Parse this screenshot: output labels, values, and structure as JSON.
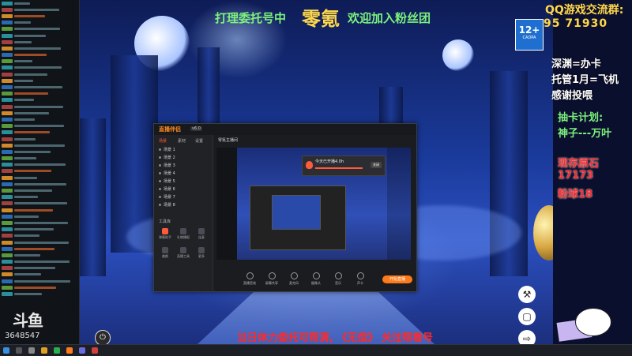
{
  "overlay": {
    "top_left": "打理委托号中",
    "streamer_name": "零氪",
    "top_right": "欢迎加入粉丝团",
    "qq_label": "QQ游戏交流群:",
    "qq_number": "95  71930",
    "right_notes": [
      {
        "text": "深渊=办卡",
        "style": "white"
      },
      {
        "text": "托管1月=飞机",
        "style": "white"
      },
      {
        "text": "感谢投喂",
        "style": "white"
      },
      {
        "text": "抽卡计划:",
        "style": "green"
      },
      {
        "text": "神子---万叶",
        "style": "green"
      },
      {
        "text": "现存原石",
        "style": "red"
      },
      {
        "text": "17173",
        "style": "red"
      },
      {
        "text": "粉球18",
        "style": "red"
      }
    ],
    "bottom_text": "当日体力委托可帮清, 《无偿》   关注帮看号",
    "age_rating": {
      "number": "12+",
      "sub": "CADPA"
    }
  },
  "chat": {
    "viewer_count": "3648547",
    "logo": "斗鱼",
    "row_count": 46
  },
  "app": {
    "logo": "直播伴侣",
    "version": "v6.0",
    "room_title": "零氪主播间",
    "scene_tabs": [
      "场景",
      "素材",
      "设置"
    ],
    "scenes": [
      "场景 1",
      "场景 2",
      "场景 3",
      "场景 4",
      "场景 5",
      "场景 6",
      "场景 7",
      "场景 8"
    ],
    "tools_label": "工具库",
    "tools": [
      "弹幕助手",
      "礼物播报",
      "连麦",
      "美颜",
      "直播工具",
      "更多"
    ],
    "notify_text": "今天已开播4.0h",
    "notify_button": "关闭",
    "bottom_buttons": [
      "直播音效",
      "屏幕共享",
      "麦克风",
      "摄像头",
      "音乐",
      "声卡"
    ],
    "start_button": "开始直播"
  },
  "side_buttons": [
    "wrench-icon",
    "message-icon",
    "exit-icon"
  ],
  "colors": {
    "green": "#7cf27c",
    "yellow": "#ffd84a",
    "red": "#ff2a2a",
    "accent": "#ff7a1a"
  }
}
